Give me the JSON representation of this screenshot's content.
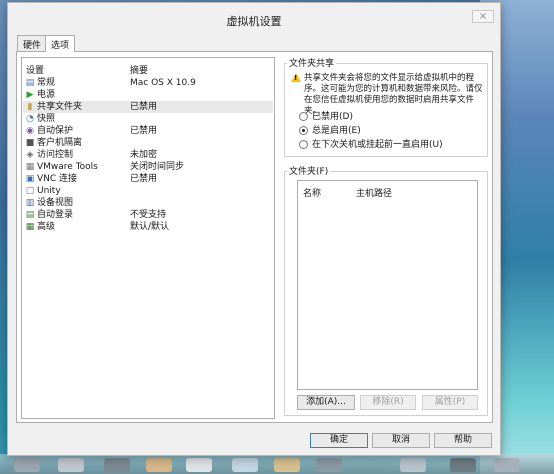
{
  "window": {
    "title": "虚拟机设置",
    "close_glyph": "×"
  },
  "tabs": [
    {
      "label": "硬件",
      "active": false
    },
    {
      "label": "选项",
      "active": true
    }
  ],
  "settings_list": {
    "col_setting": "设置",
    "col_summary": "摘要",
    "items": [
      {
        "name": "常规",
        "summary": "Mac OS X 10.9",
        "icon": "general-icon",
        "glyph": "▤",
        "color": "#4a7ab0"
      },
      {
        "name": "电源",
        "summary": "",
        "icon": "power-icon",
        "glyph": "▶",
        "color": "#2aa02a"
      },
      {
        "name": "共享文件夹",
        "summary": "已禁用",
        "icon": "shared-folder-icon",
        "glyph": "▮",
        "color": "#c9a23a",
        "selected": true
      },
      {
        "name": "快照",
        "summary": "",
        "icon": "snapshot-icon",
        "glyph": "◔",
        "color": "#5a6fa0"
      },
      {
        "name": "自动保护",
        "summary": "已禁用",
        "icon": "autoprotect-icon",
        "glyph": "◉",
        "color": "#7a5aa8"
      },
      {
        "name": "客户机隔离",
        "summary": "",
        "icon": "isolation-icon",
        "glyph": "■",
        "color": "#555555"
      },
      {
        "name": "访问控制",
        "summary": "未加密",
        "icon": "access-control-icon",
        "glyph": "◈",
        "color": "#666666"
      },
      {
        "name": "VMware Tools",
        "summary": "关闭时间同步",
        "icon": "vmware-tools-icon",
        "glyph": "▦",
        "color": "#777777"
      },
      {
        "name": "VNC 连接",
        "summary": "已禁用",
        "icon": "vnc-icon",
        "glyph": "▣",
        "color": "#3a6fb0"
      },
      {
        "name": "Unity",
        "summary": "",
        "icon": "unity-icon",
        "glyph": "▢",
        "color": "#3a7ac0"
      },
      {
        "name": "设备视图",
        "summary": "",
        "icon": "device-view-icon",
        "glyph": "▥",
        "color": "#4a6a90"
      },
      {
        "name": "自动登录",
        "summary": "不受支持",
        "icon": "autologin-icon",
        "glyph": "▤",
        "color": "#3a8a3a"
      },
      {
        "name": "高级",
        "summary": "默认/默认",
        "icon": "advanced-icon",
        "glyph": "▦",
        "color": "#3a7a3a"
      }
    ]
  },
  "folder_sharing": {
    "title": "文件夹共享",
    "warning": "共享文件夹会将您的文件显示给虚拟机中的程序。这可能为您的计算机和数据带来风险。请仅在您信任虚拟机使用您的数据时启用共享文件夹。",
    "options": [
      {
        "label": "已禁用(D)",
        "checked": false
      },
      {
        "label": "总是启用(E)",
        "checked": true
      },
      {
        "label": "在下次关机或挂起前一直启用(U)",
        "checked": false
      }
    ]
  },
  "folders": {
    "title": "文件夹(F)",
    "col_name": "名称",
    "col_path": "主机路径",
    "add_label": "添加(A)...",
    "remove_label": "移除(R)",
    "properties_label": "属性(P)"
  },
  "footer": {
    "ok_label": "确定",
    "cancel_label": "取消",
    "help_label": "帮助"
  }
}
